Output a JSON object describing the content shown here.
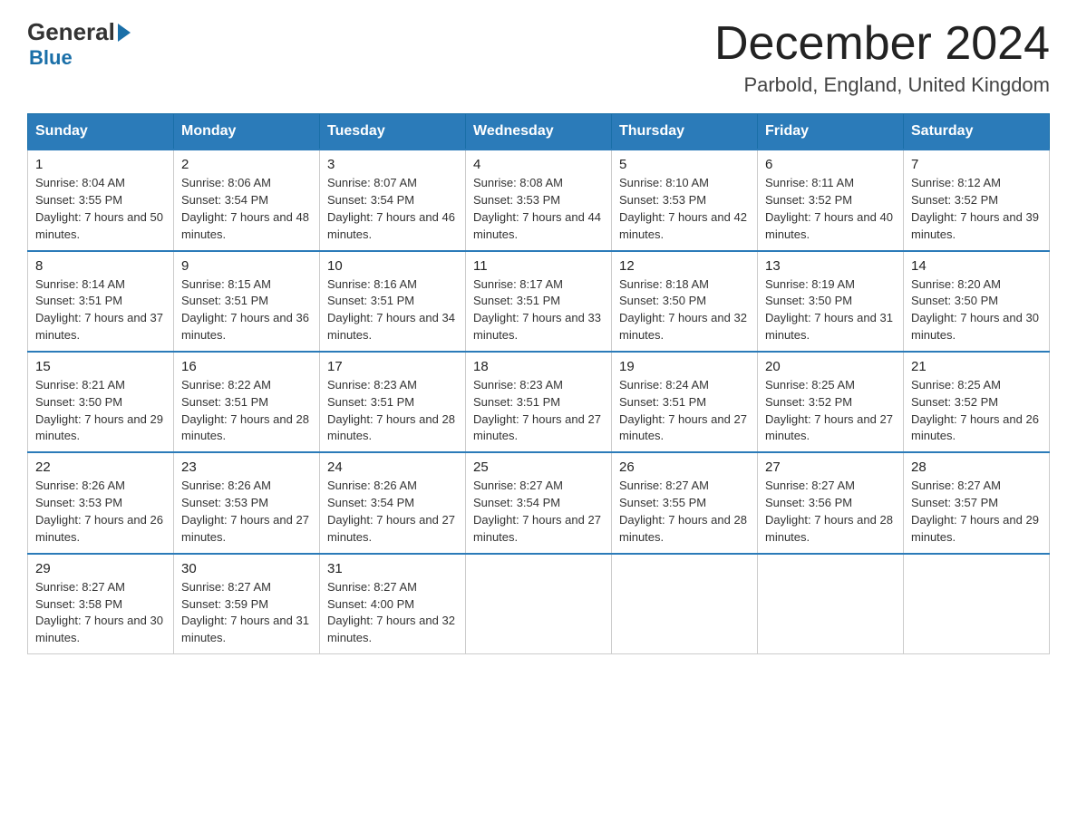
{
  "header": {
    "logo_general": "General",
    "logo_blue": "Blue",
    "month_year": "December 2024",
    "location": "Parbold, England, United Kingdom"
  },
  "days_of_week": [
    "Sunday",
    "Monday",
    "Tuesday",
    "Wednesday",
    "Thursday",
    "Friday",
    "Saturday"
  ],
  "weeks": [
    [
      {
        "day": "1",
        "sunrise": "Sunrise: 8:04 AM",
        "sunset": "Sunset: 3:55 PM",
        "daylight": "Daylight: 7 hours and 50 minutes."
      },
      {
        "day": "2",
        "sunrise": "Sunrise: 8:06 AM",
        "sunset": "Sunset: 3:54 PM",
        "daylight": "Daylight: 7 hours and 48 minutes."
      },
      {
        "day": "3",
        "sunrise": "Sunrise: 8:07 AM",
        "sunset": "Sunset: 3:54 PM",
        "daylight": "Daylight: 7 hours and 46 minutes."
      },
      {
        "day": "4",
        "sunrise": "Sunrise: 8:08 AM",
        "sunset": "Sunset: 3:53 PM",
        "daylight": "Daylight: 7 hours and 44 minutes."
      },
      {
        "day": "5",
        "sunrise": "Sunrise: 8:10 AM",
        "sunset": "Sunset: 3:53 PM",
        "daylight": "Daylight: 7 hours and 42 minutes."
      },
      {
        "day": "6",
        "sunrise": "Sunrise: 8:11 AM",
        "sunset": "Sunset: 3:52 PM",
        "daylight": "Daylight: 7 hours and 40 minutes."
      },
      {
        "day": "7",
        "sunrise": "Sunrise: 8:12 AM",
        "sunset": "Sunset: 3:52 PM",
        "daylight": "Daylight: 7 hours and 39 minutes."
      }
    ],
    [
      {
        "day": "8",
        "sunrise": "Sunrise: 8:14 AM",
        "sunset": "Sunset: 3:51 PM",
        "daylight": "Daylight: 7 hours and 37 minutes."
      },
      {
        "day": "9",
        "sunrise": "Sunrise: 8:15 AM",
        "sunset": "Sunset: 3:51 PM",
        "daylight": "Daylight: 7 hours and 36 minutes."
      },
      {
        "day": "10",
        "sunrise": "Sunrise: 8:16 AM",
        "sunset": "Sunset: 3:51 PM",
        "daylight": "Daylight: 7 hours and 34 minutes."
      },
      {
        "day": "11",
        "sunrise": "Sunrise: 8:17 AM",
        "sunset": "Sunset: 3:51 PM",
        "daylight": "Daylight: 7 hours and 33 minutes."
      },
      {
        "day": "12",
        "sunrise": "Sunrise: 8:18 AM",
        "sunset": "Sunset: 3:50 PM",
        "daylight": "Daylight: 7 hours and 32 minutes."
      },
      {
        "day": "13",
        "sunrise": "Sunrise: 8:19 AM",
        "sunset": "Sunset: 3:50 PM",
        "daylight": "Daylight: 7 hours and 31 minutes."
      },
      {
        "day": "14",
        "sunrise": "Sunrise: 8:20 AM",
        "sunset": "Sunset: 3:50 PM",
        "daylight": "Daylight: 7 hours and 30 minutes."
      }
    ],
    [
      {
        "day": "15",
        "sunrise": "Sunrise: 8:21 AM",
        "sunset": "Sunset: 3:50 PM",
        "daylight": "Daylight: 7 hours and 29 minutes."
      },
      {
        "day": "16",
        "sunrise": "Sunrise: 8:22 AM",
        "sunset": "Sunset: 3:51 PM",
        "daylight": "Daylight: 7 hours and 28 minutes."
      },
      {
        "day": "17",
        "sunrise": "Sunrise: 8:23 AM",
        "sunset": "Sunset: 3:51 PM",
        "daylight": "Daylight: 7 hours and 28 minutes."
      },
      {
        "day": "18",
        "sunrise": "Sunrise: 8:23 AM",
        "sunset": "Sunset: 3:51 PM",
        "daylight": "Daylight: 7 hours and 27 minutes."
      },
      {
        "day": "19",
        "sunrise": "Sunrise: 8:24 AM",
        "sunset": "Sunset: 3:51 PM",
        "daylight": "Daylight: 7 hours and 27 minutes."
      },
      {
        "day": "20",
        "sunrise": "Sunrise: 8:25 AM",
        "sunset": "Sunset: 3:52 PM",
        "daylight": "Daylight: 7 hours and 27 minutes."
      },
      {
        "day": "21",
        "sunrise": "Sunrise: 8:25 AM",
        "sunset": "Sunset: 3:52 PM",
        "daylight": "Daylight: 7 hours and 26 minutes."
      }
    ],
    [
      {
        "day": "22",
        "sunrise": "Sunrise: 8:26 AM",
        "sunset": "Sunset: 3:53 PM",
        "daylight": "Daylight: 7 hours and 26 minutes."
      },
      {
        "day": "23",
        "sunrise": "Sunrise: 8:26 AM",
        "sunset": "Sunset: 3:53 PM",
        "daylight": "Daylight: 7 hours and 27 minutes."
      },
      {
        "day": "24",
        "sunrise": "Sunrise: 8:26 AM",
        "sunset": "Sunset: 3:54 PM",
        "daylight": "Daylight: 7 hours and 27 minutes."
      },
      {
        "day": "25",
        "sunrise": "Sunrise: 8:27 AM",
        "sunset": "Sunset: 3:54 PM",
        "daylight": "Daylight: 7 hours and 27 minutes."
      },
      {
        "day": "26",
        "sunrise": "Sunrise: 8:27 AM",
        "sunset": "Sunset: 3:55 PM",
        "daylight": "Daylight: 7 hours and 28 minutes."
      },
      {
        "day": "27",
        "sunrise": "Sunrise: 8:27 AM",
        "sunset": "Sunset: 3:56 PM",
        "daylight": "Daylight: 7 hours and 28 minutes."
      },
      {
        "day": "28",
        "sunrise": "Sunrise: 8:27 AM",
        "sunset": "Sunset: 3:57 PM",
        "daylight": "Daylight: 7 hours and 29 minutes."
      }
    ],
    [
      {
        "day": "29",
        "sunrise": "Sunrise: 8:27 AM",
        "sunset": "Sunset: 3:58 PM",
        "daylight": "Daylight: 7 hours and 30 minutes."
      },
      {
        "day": "30",
        "sunrise": "Sunrise: 8:27 AM",
        "sunset": "Sunset: 3:59 PM",
        "daylight": "Daylight: 7 hours and 31 minutes."
      },
      {
        "day": "31",
        "sunrise": "Sunrise: 8:27 AM",
        "sunset": "Sunset: 4:00 PM",
        "daylight": "Daylight: 7 hours and 32 minutes."
      },
      null,
      null,
      null,
      null
    ]
  ]
}
